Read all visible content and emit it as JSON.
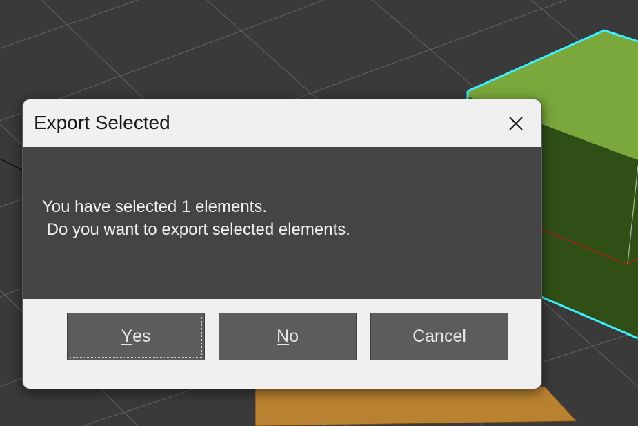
{
  "dialog": {
    "title": "Export Selected",
    "message": "You have selected 1 elements.\n Do you want to export selected elements.",
    "buttons": {
      "yes": {
        "label_underlined": "Y",
        "label_rest": "es"
      },
      "no": {
        "label_underlined": "N",
        "label_rest": "o"
      },
      "cancel": {
        "label": "Cancel"
      }
    }
  },
  "icons": {
    "close": "close-icon"
  },
  "colors": {
    "viewport_bg": "#3a3a3a",
    "grid_line": "#5c5c5c",
    "cube_top": "#7aa83c",
    "cube_side": "#2f4f16",
    "cube_outline": "#3ef0ff",
    "floor_plane": "#b98231",
    "dialog_body": "#444444",
    "dialog_frame": "#f0f0f0",
    "button_bg": "#5c5c5c"
  }
}
